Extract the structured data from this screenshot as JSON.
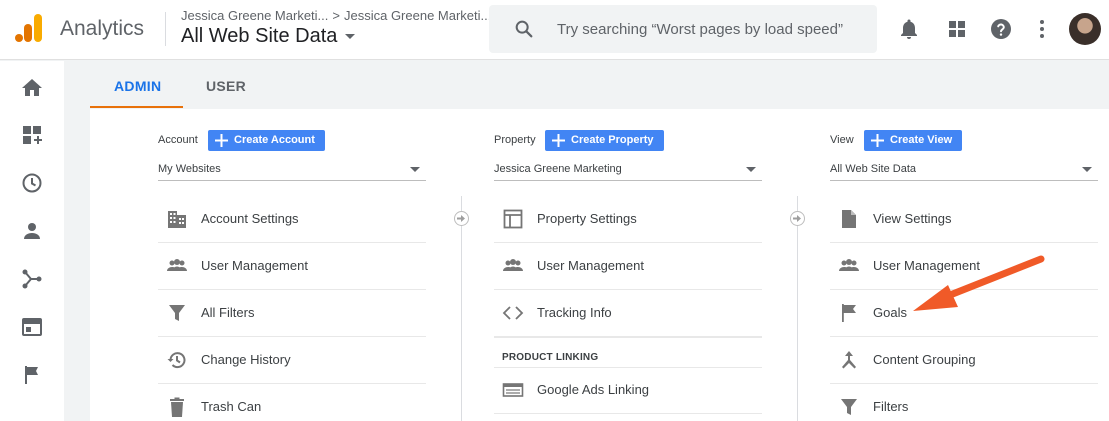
{
  "header": {
    "app_name": "Analytics",
    "breadcrumb": [
      "Jessica Greene Marketi...",
      "Jessica Greene Marketi..."
    ],
    "property_title": "All Web Site Data",
    "search_placeholder": "Try searching “Worst pages by load speed”"
  },
  "header_icons": [
    "notifications-icon",
    "apps-grid-icon",
    "help-icon",
    "more-vert-icon",
    "avatar"
  ],
  "rail_icons": [
    "home-icon",
    "customization-icon",
    "realtime-clock-icon",
    "audience-person-icon",
    "acquisition-icon",
    "behavior-icon",
    "conversions-flag-icon"
  ],
  "tabs": [
    {
      "label": "ADMIN",
      "active": true
    },
    {
      "label": "USER",
      "active": false
    }
  ],
  "columns": {
    "account": {
      "label": "Account",
      "create_label": "Create Account",
      "selected": "My Websites",
      "items": [
        {
          "label": "Account Settings",
          "icon": "building-icon"
        },
        {
          "label": "User Management",
          "icon": "people-icon"
        },
        {
          "label": "All Filters",
          "icon": "filter-icon"
        },
        {
          "label": "Change History",
          "icon": "history-icon"
        },
        {
          "label": "Trash Can",
          "icon": "trash-icon"
        }
      ]
    },
    "property": {
      "label": "Property",
      "create_label": "Create Property",
      "selected": "Jessica Greene Marketing",
      "items": [
        {
          "label": "Property Settings",
          "icon": "web-window-icon"
        },
        {
          "label": "User Management",
          "icon": "people-icon"
        },
        {
          "label": "Tracking Info",
          "icon": "code-icon"
        }
      ],
      "section": "PRODUCT LINKING",
      "section_items": [
        {
          "label": "Google Ads Linking",
          "icon": "ads-linking-icon"
        }
      ]
    },
    "view": {
      "label": "View",
      "create_label": "Create View",
      "selected": "All Web Site Data",
      "items": [
        {
          "label": "View Settings",
          "icon": "document-icon"
        },
        {
          "label": "User Management",
          "icon": "people-icon"
        },
        {
          "label": "Goals",
          "icon": "flag-icon"
        },
        {
          "label": "Content Grouping",
          "icon": "content-grouping-icon"
        },
        {
          "label": "Filters",
          "icon": "filter-icon"
        }
      ]
    }
  },
  "colors": {
    "accent_blue": "#4285f4",
    "tab_blue": "#1a73e8",
    "tab_underline": "#e8710a",
    "annotation_arrow": "#f05a28"
  }
}
